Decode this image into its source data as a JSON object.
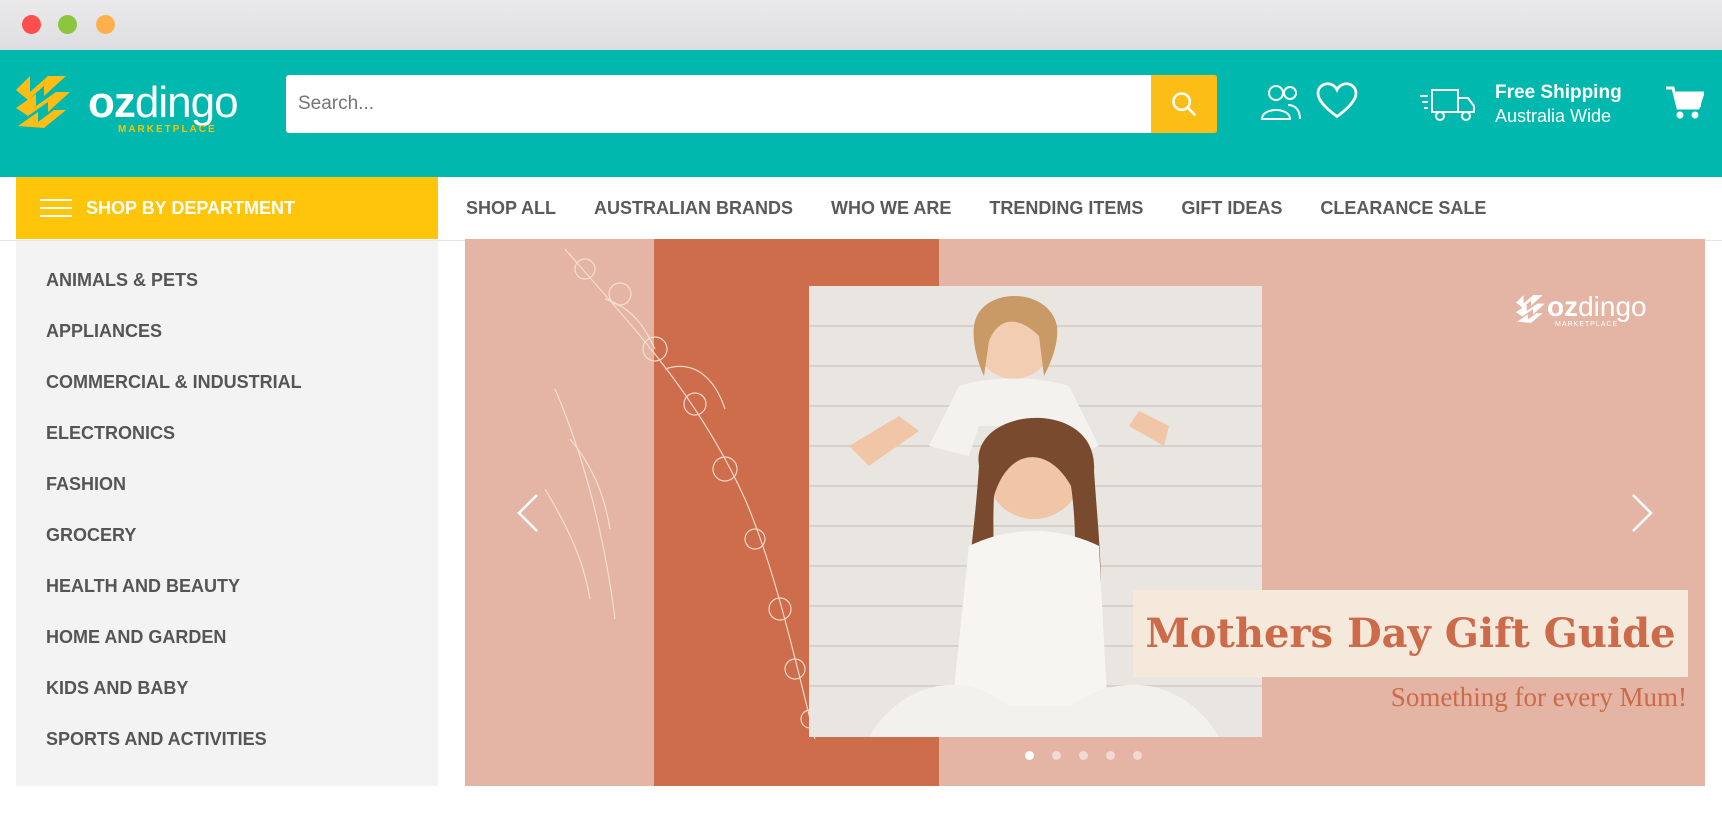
{
  "header": {
    "logo_main_bold": "oz",
    "logo_main_light": "dingo",
    "logo_sub": "MARKETPLACE",
    "search_placeholder": "Search...",
    "shipping_title": "Free Shipping",
    "shipping_sub": "Australia Wide"
  },
  "nav": {
    "department_label": "SHOP BY DEPARTMENT",
    "links": [
      "SHOP ALL",
      "AUSTRALIAN BRANDS",
      "WHO WE ARE",
      "TRENDING ITEMS",
      "GIFT IDEAS",
      "CLEARANCE SALE"
    ]
  },
  "sidebar": {
    "items": [
      "ANIMALS & PETS",
      "APPLIANCES",
      "COMMERCIAL & INDUSTRIAL",
      "ELECTRONICS",
      "FASHION",
      "GROCERY",
      "HEALTH AND BEAUTY",
      "HOME AND GARDEN",
      "KIDS AND BABY",
      "SPORTS AND ACTIVITIES"
    ]
  },
  "banner": {
    "title": "Mothers Day Gift Guide",
    "subtitle": "Something for every Mum!",
    "logo_bold": "oz",
    "logo_light": "dingo",
    "logo_sub": "MARKETPLACE",
    "slide_count": 5,
    "active_slide": 1
  },
  "colors": {
    "teal": "#00b8ad",
    "yellow": "#fec50a",
    "banner_bg": "#e4b4a4",
    "banner_band": "#cd6d4b",
    "caption": "#cc6a4a"
  },
  "icons": [
    "search-icon",
    "account-icon",
    "heart-icon",
    "truck-icon",
    "cart-icon",
    "hamburger-icon",
    "chevron-left-icon",
    "chevron-right-icon"
  ]
}
